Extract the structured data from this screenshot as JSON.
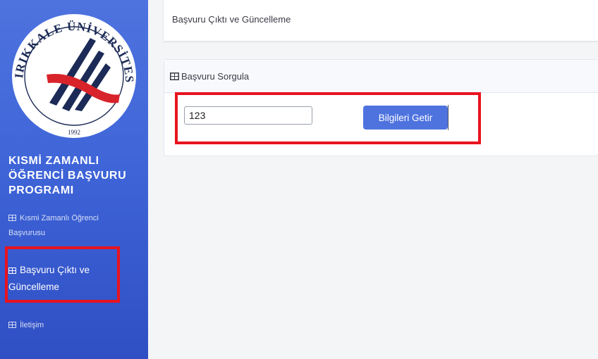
{
  "sidebar": {
    "logo": {
      "arc_text": "KIRIKKALE ÜNİVERSİTESİ",
      "year": "1992"
    },
    "brand": [
      "KISMİ ZAMANLI",
      "ÖĞRENCİ BAŞVURU",
      "PROGRAMI"
    ],
    "items": [
      {
        "label_lines": [
          "Kısmi Zamanlı Öğrenci",
          "Başvurusu"
        ],
        "icon": "table-icon"
      },
      {
        "label_lines": [
          "Başvuru Çıktı ve",
          "Güncelleme"
        ],
        "icon": "table-icon",
        "active": true
      },
      {
        "label_lines": [
          "İletişim"
        ],
        "icon": "table-icon"
      }
    ]
  },
  "topbar": {
    "title": "Başvuru Çıktı ve Güncelleme"
  },
  "card": {
    "title": "Başvuru Sorgula",
    "input_value": "123",
    "button_label": "Bilgileri Getir"
  },
  "colors": {
    "primary": "#4e73df",
    "highlight": "#e8131f",
    "logo_red": "#d8232a",
    "logo_navy": "#1b2a56"
  }
}
